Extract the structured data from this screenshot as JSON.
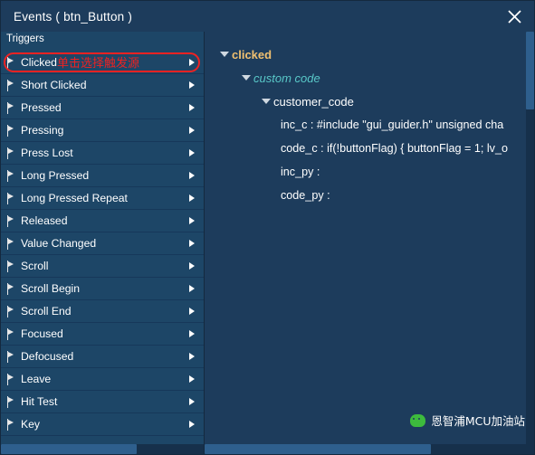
{
  "window": {
    "title": "Events ( btn_Button )",
    "close_icon": "close-icon"
  },
  "left": {
    "header": "Triggers",
    "annotation": "单击选择触发源",
    "selected_index": 0,
    "items": [
      {
        "label": "Clicked"
      },
      {
        "label": "Short Clicked"
      },
      {
        "label": "Pressed"
      },
      {
        "label": "Pressing"
      },
      {
        "label": "Press Lost"
      },
      {
        "label": "Long Pressed"
      },
      {
        "label": "Long Pressed Repeat"
      },
      {
        "label": "Released"
      },
      {
        "label": "Value Changed"
      },
      {
        "label": "Scroll"
      },
      {
        "label": "Scroll Begin"
      },
      {
        "label": "Scroll End"
      },
      {
        "label": "Focused"
      },
      {
        "label": "Defocused"
      },
      {
        "label": "Leave"
      },
      {
        "label": "Hit Test"
      },
      {
        "label": "Key"
      }
    ]
  },
  "right": {
    "root": "clicked",
    "child": "custom code",
    "group": "customer_code",
    "leaves": [
      "inc_c : #include \"gui_guider.h\" unsigned cha",
      "code_c : if(!buttonFlag) { buttonFlag = 1; lv_o",
      "inc_py :",
      "code_py :"
    ]
  },
  "watermark": {
    "text": "恩智浦MCU加油站",
    "icon": "wechat-icon"
  }
}
